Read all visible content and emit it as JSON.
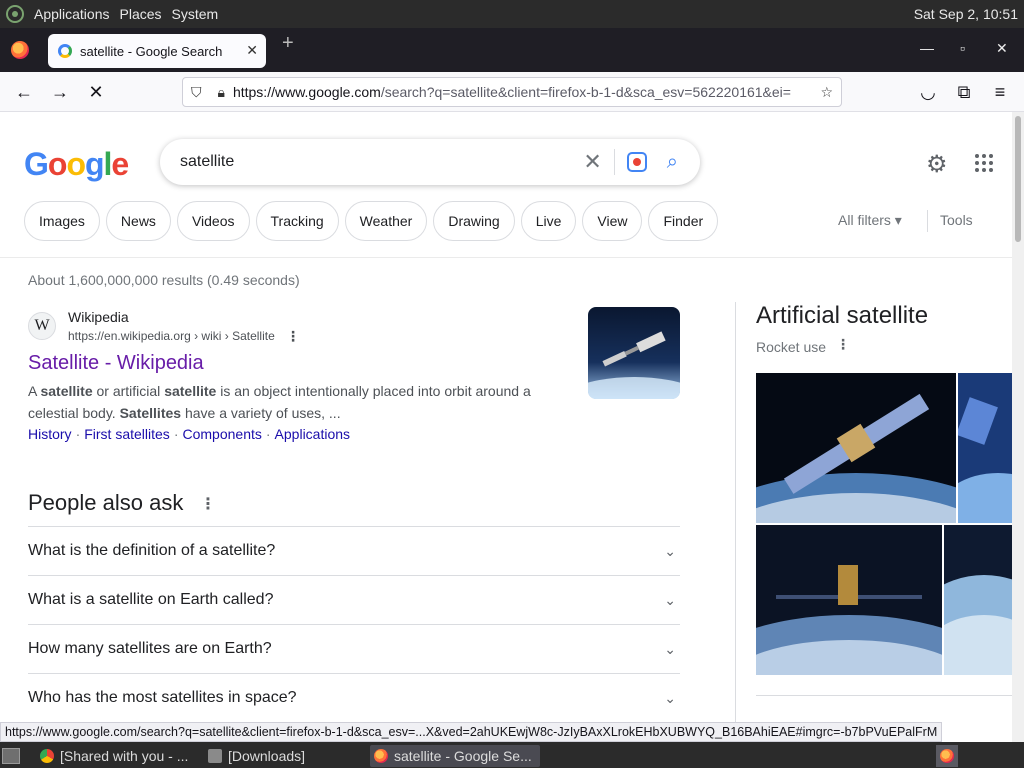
{
  "os_panel": {
    "menu": [
      "Applications",
      "Places",
      "System"
    ],
    "clock": "Sat Sep  2, 10:51"
  },
  "browser": {
    "tab_title": "satellite - Google Search",
    "url_prefix": "https://www.google.com",
    "url_rest": "/search?q=satellite&client=firefox-b-1-d&sca_esv=562220161&ei="
  },
  "search": {
    "logo": "Google",
    "query": "satellite",
    "chips": [
      "Images",
      "News",
      "Videos",
      "Tracking",
      "Weather",
      "Drawing",
      "Live",
      "View",
      "Finder"
    ],
    "all_filters": "All filters",
    "tools": "Tools",
    "stats": "About 1,600,000,000 results (0.49 seconds)"
  },
  "result": {
    "site": "Wikipedia",
    "cite": "https://en.wikipedia.org › wiki › Satellite",
    "title": "Satellite - Wikipedia",
    "snippet_parts": [
      "A ",
      "satellite",
      " or artificial ",
      "satellite",
      " is an object intentionally placed into orbit around a celestial body. ",
      "Satellites",
      " have a variety of uses, ..."
    ],
    "sitelinks": [
      "History",
      "First satellites",
      "Components",
      "Applications"
    ]
  },
  "paa": {
    "title": "People also ask",
    "questions": [
      "What is the definition of a satellite?",
      "What is a satellite on Earth called?",
      "How many satellites are on Earth?",
      "Who has the most satellites in space?"
    ]
  },
  "knowledge_panel": {
    "title": "Artificial satellite",
    "subtitle": "Rocket use"
  },
  "status_url": "https://www.google.com/search?q=satellite&client=firefox-b-1-d&sca_esv=...X&ved=2ahUKEwjW8c-JzIyBAxXLrokEHbXUBWYQ_B16BAhiEAE#imgrc=-b7bPVuEPalFrM",
  "taskbar": {
    "items": [
      "[Shared with you - ...",
      "[Downloads]",
      "satellite - Google Se..."
    ]
  },
  "colors": {
    "link": "#1a0dab",
    "visited": "#681da8",
    "blue": "#4285f4",
    "red": "#ea4335",
    "yellow": "#fbbc05",
    "green": "#34a853"
  }
}
